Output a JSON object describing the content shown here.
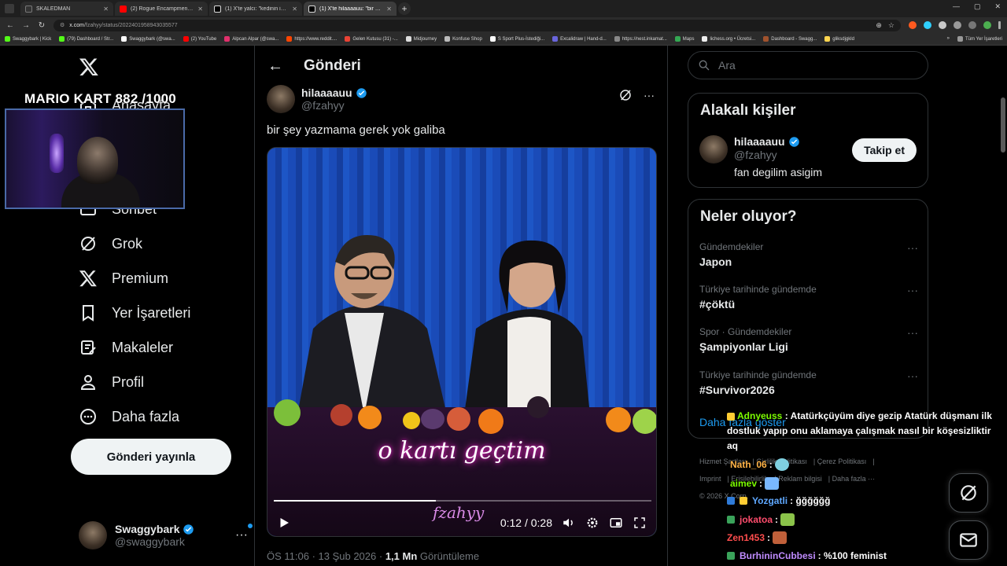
{
  "browser": {
    "tabs": [
      {
        "title": "SKALEDMAN",
        "active": false
      },
      {
        "title": "(2) Rogue Encampment M...",
        "active": false
      },
      {
        "title": "(1) X'te yalcı: \"kedinin ismini d...",
        "active": false
      },
      {
        "title": "(1) X'te hilaaaauu: \"bir şey y...",
        "active": true
      }
    ],
    "url_host": "x.com",
    "url_path": "/fzahyy/status/2022401958943035577",
    "bookmarks": [
      "Swaggybark | Kick",
      "(79) Dashboard / Str...",
      "Swaggybark (@swa...",
      "(2) YouTube",
      "Alpcan Alpar (@swa...",
      "https://www.reddit....",
      "Gelen Kutusu (31) -...",
      "Midjourney",
      "Konfuse Shop",
      "S Sport Plus-İstediği...",
      "Excalidraw | Hand-d...",
      "https://nest.inkamat...",
      "Maps",
      "lichess.org • Ücretsi...",
      "Dashboard - Swagg...",
      "gliksdjgkld"
    ],
    "bookmarks_right": "Tüm Yer İşaretleri"
  },
  "stream_overlay": {
    "title": "MARIO KART  882 /1000"
  },
  "leftnav": {
    "items": [
      {
        "label": "Anasayfa",
        "icon": "home-icon"
      },
      {
        "label": "Sohbet",
        "icon": "chat-icon"
      },
      {
        "label": "Grok",
        "icon": "grok-icon"
      },
      {
        "label": "Premium",
        "icon": "x-icon"
      },
      {
        "label": "Yer İşaretleri",
        "icon": "bookmark-icon"
      },
      {
        "label": "Makaleler",
        "icon": "article-icon"
      },
      {
        "label": "Profil",
        "icon": "profile-icon"
      },
      {
        "label": "Daha fazla",
        "icon": "more-icon"
      }
    ],
    "post_button": "Gönderi yayınla",
    "account": {
      "name": "Swaggybark",
      "handle": "@swaggybark"
    }
  },
  "post": {
    "header": "Gönderi",
    "author_name": "hilaaaauu",
    "author_handle": "@fzahyy",
    "text": "bir şey yazmama gerek yok galiba",
    "video": {
      "caption": "o kartı geçtim",
      "watermark": "fzahyy",
      "time_current": "0:12",
      "time_total": "0:28",
      "progress_fraction": 0.43
    },
    "meta_time": "ÖS 11:06 · 13 Şub 2026 · ",
    "meta_views": "1,1 Mn",
    "meta_views_label": " Görüntüleme"
  },
  "sidebar": {
    "search_placeholder": "Ara",
    "related": {
      "title": "Alakalı kişiler",
      "name": "hilaaaauu",
      "handle": "@fzahyy",
      "bio": "fan degilim asigim",
      "follow_label": "Takip et"
    },
    "trends": {
      "title": "Neler oluyor?",
      "items": [
        {
          "context": "Gündemdekiler",
          "topic": "Japon"
        },
        {
          "context": "Türkiye tarihinde gündemde",
          "topic": "#çöktü"
        },
        {
          "context": "Spor · Gündemdekiler",
          "topic": "Şampiyonlar Ligi"
        },
        {
          "context": "Türkiye tarihinde gündemde",
          "topic": "#Survivor2026"
        }
      ],
      "show_more": "Daha fazla göster"
    },
    "footer": [
      "Hizmet Şartları",
      "Gizlilik Politikası",
      "Çerez Politikası",
      "Imprint",
      "Erişilebilirlik",
      "Reklam bilgisi",
      "Daha fazla ···",
      "© 2026 X Corp."
    ]
  },
  "chat": [
    {
      "user": "Adnyeuss",
      "color": "#7cfc00",
      "text": ": Atatürkçüyüm diye gezip Atatürk düşmanı ilk dostluk yapıp onu aklamaya çalışmak nasıl bir köşesizliktir aq"
    },
    {
      "user": "Nath_06",
      "color": "#ffb347",
      "text": ":"
    },
    {
      "user": "aimev",
      "color": "#7cfc00",
      "text": ":"
    },
    {
      "user": "Yozgatli",
      "color": "#5fa8ff",
      "text": ": ğğğğğğ"
    },
    {
      "user": "jokatoa",
      "color": "#ff4d6d",
      "text": ":"
    },
    {
      "user": "Zen1453",
      "color": "#ff4d4d",
      "text": ":"
    },
    {
      "user": "BurhininCubbesi",
      "color": "#c08cff",
      "text": ": %100 feminist"
    }
  ]
}
